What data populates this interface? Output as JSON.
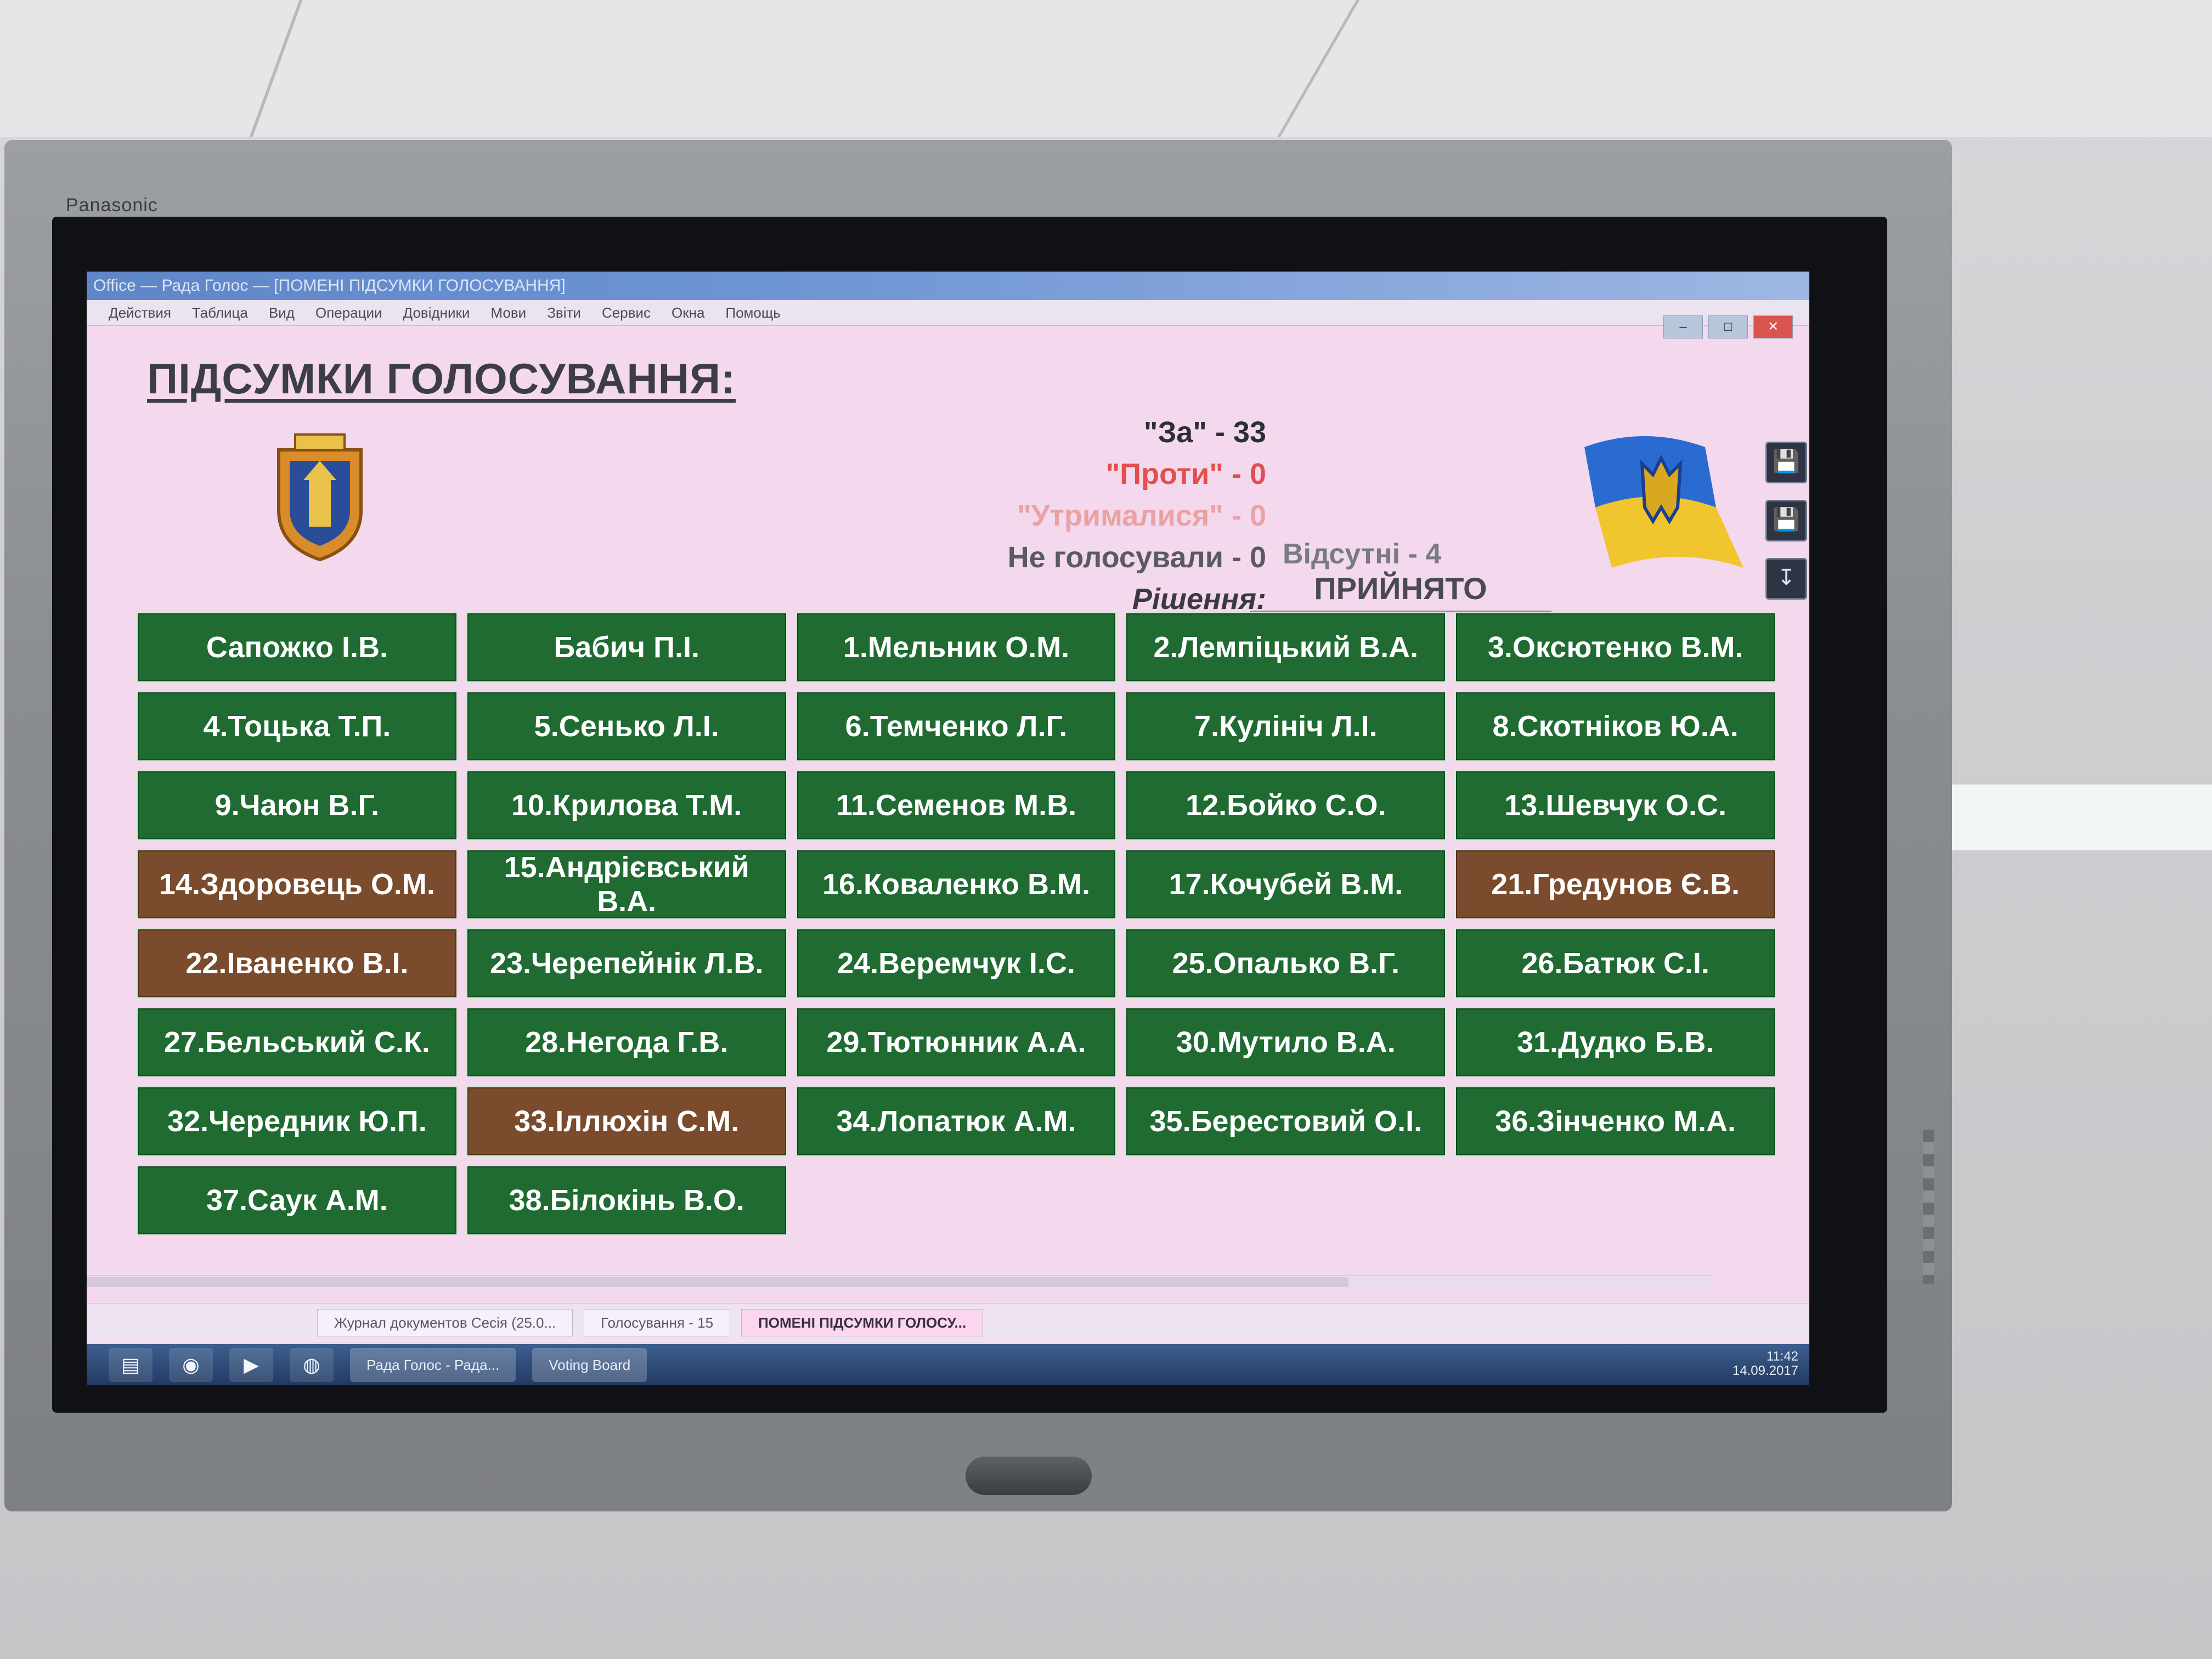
{
  "window": {
    "title": "Office — Рада Голос — [ПОМЕНІ ПІДСУМКИ ГОЛОСУВАННЯ]",
    "menu": [
      "Действия",
      "Таблица",
      "Вид",
      "Операции",
      "Довідники",
      "Мови",
      "Звіти",
      "Сервис",
      "Окна",
      "Помощь"
    ],
    "controls": {
      "minimize": "–",
      "maximize": "□",
      "close": "✕"
    }
  },
  "header": {
    "title": "ПІДСУМКИ ГОЛОСУВАННЯ:"
  },
  "results": {
    "za": "\"За\" - 33",
    "proty": "\"Проти\" - 0",
    "utrymalysia": "\"Утрималися\" - 0",
    "ne_holosuvaly": "Не голосували - 0",
    "rishennia_label": "Рішення:",
    "absent": "Відсутні - 4",
    "decision": "ПРИЙНЯТО"
  },
  "deputies": [
    {
      "name": "Сапожко І.В.",
      "status": "present"
    },
    {
      "name": "Бабич П.І.",
      "status": "present"
    },
    {
      "name": "1.Мельник О.М.",
      "status": "present"
    },
    {
      "name": "2.Лемпіцький В.А.",
      "status": "present"
    },
    {
      "name": "3.Оксютенко В.М.",
      "status": "present"
    },
    {
      "name": "4.Тоцька Т.П.",
      "status": "present"
    },
    {
      "name": "5.Сенько Л.І.",
      "status": "present"
    },
    {
      "name": "6.Темченко Л.Г.",
      "status": "present"
    },
    {
      "name": "7.Кулініч Л.І.",
      "status": "present"
    },
    {
      "name": "8.Скотніков Ю.А.",
      "status": "present"
    },
    {
      "name": "9.Чаюн В.Г.",
      "status": "present"
    },
    {
      "name": "10.Крилова Т.М.",
      "status": "present"
    },
    {
      "name": "11.Семенов М.В.",
      "status": "present"
    },
    {
      "name": "12.Бойко С.О.",
      "status": "present"
    },
    {
      "name": "13.Шевчук О.С.",
      "status": "present"
    },
    {
      "name": "14.Здоровець О.М.",
      "status": "absent"
    },
    {
      "name": "15.Андрієвський В.А.",
      "status": "present"
    },
    {
      "name": "16.Коваленко В.М.",
      "status": "present"
    },
    {
      "name": "17.Кочубей В.М.",
      "status": "present"
    },
    {
      "name": "21.Гредунов Є.В.",
      "status": "absent"
    },
    {
      "name": "22.Іваненко В.І.",
      "status": "absent"
    },
    {
      "name": "23.Черепейнік Л.В.",
      "status": "present"
    },
    {
      "name": "24.Веремчук І.С.",
      "status": "present"
    },
    {
      "name": "25.Опалько В.Г.",
      "status": "present"
    },
    {
      "name": "26.Батюк С.І.",
      "status": "present"
    },
    {
      "name": "27.Бельський С.К.",
      "status": "present"
    },
    {
      "name": "28.Негода Г.В.",
      "status": "present"
    },
    {
      "name": "29.Тютюнник А.А.",
      "status": "present"
    },
    {
      "name": "30.Мутило В.А.",
      "status": "present"
    },
    {
      "name": "31.Дудко Б.В.",
      "status": "present"
    },
    {
      "name": "32.Чередник Ю.П.",
      "status": "present"
    },
    {
      "name": "33.Іллюхін С.М.",
      "status": "absent"
    },
    {
      "name": "34.Лопатюк А.М.",
      "status": "present"
    },
    {
      "name": "35.Берестовий О.І.",
      "status": "present"
    },
    {
      "name": "36.Зінченко М.А.",
      "status": "present"
    },
    {
      "name": "37.Саук А.М.",
      "status": "present"
    },
    {
      "name": "38.Білокінь В.О.",
      "status": "present"
    }
  ],
  "colors": {
    "present": "#1f6b32",
    "absent": "#7a4b2c",
    "screen_bg": "#f3d8ee",
    "proty": "#e0504f"
  },
  "doc_tabs": [
    {
      "label": "Журнал документов Сесія (25.0...",
      "active": false
    },
    {
      "label": "Голосування - 15",
      "active": false
    },
    {
      "label": "ПОМЕНІ ПІДСУМКИ ГОЛОСУ...",
      "active": true
    }
  ],
  "taskbar": {
    "apps": [
      "Рада Голос - Рада...",
      "Voting Board"
    ],
    "icons": [
      "folder-icon",
      "media-icon",
      "video-icon",
      "chrome-icon"
    ],
    "tray_time": "11:42",
    "tray_date": "14.09.2017"
  },
  "monitor": {
    "brand": "Panasonic"
  },
  "icons": {
    "save": "💾",
    "save2": "💾",
    "export": "↧"
  }
}
